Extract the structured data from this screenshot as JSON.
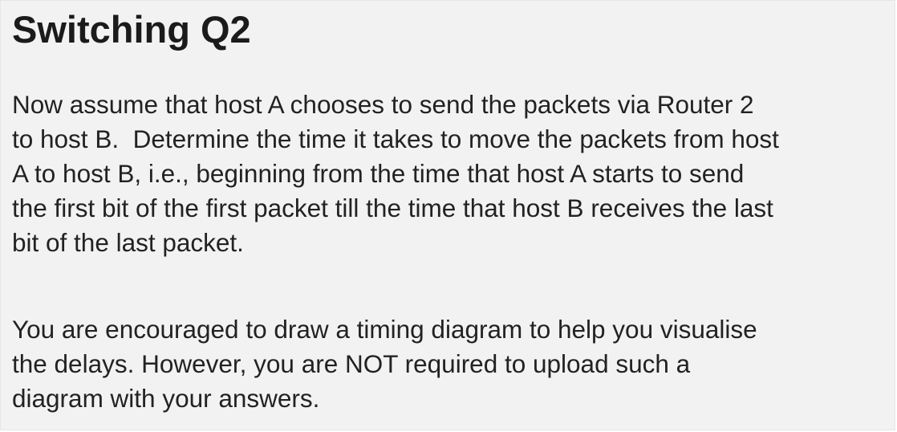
{
  "title": "Switching Q2",
  "paragraphs": [
    {
      "lines": [
        "Now assume that host A chooses to send the packets via Router 2",
        "to host B.  Determine the time it takes to move the packets from host",
        "A to host B, i.e., beginning from the time that host A starts to send",
        "the first bit of the first packet till the time that host B receives the last",
        "bit of the last packet."
      ]
    },
    {
      "lines": [
        "You are encouraged to draw a timing diagram to help you visualise",
        "the delays. However, you are NOT required to upload such a",
        "diagram with your answers."
      ]
    }
  ]
}
